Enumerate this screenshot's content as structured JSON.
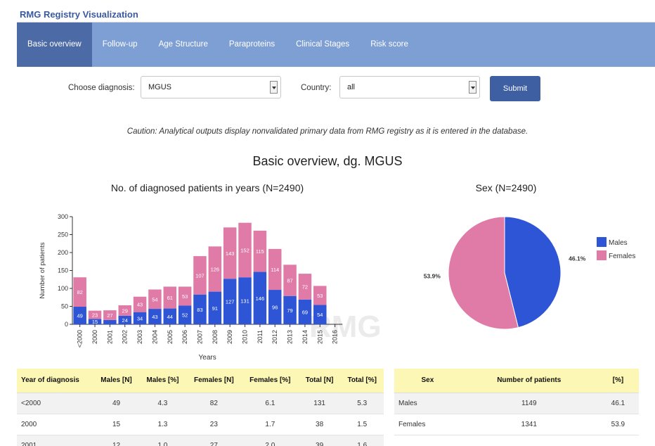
{
  "app": {
    "title": "RMG Registry Visualization"
  },
  "nav": [
    {
      "label": "Basic overview",
      "active": true
    },
    {
      "label": "Follow-up"
    },
    {
      "label": "Age Structure"
    },
    {
      "label": "Paraproteins"
    },
    {
      "label": "Clinical Stages"
    },
    {
      "label": "Risk score"
    }
  ],
  "filters": {
    "diagnosis_label": "Choose diagnosis:",
    "diagnosis_value": "MGUS",
    "country_label": "Country:",
    "country_value": "all",
    "submit_label": "Submit"
  },
  "caution": "Caution: Analytical outputs display nonvalidated primary data from RMG registry as it is entered in the database.",
  "main_title": "Basic overview, dg. MGUS",
  "colors": {
    "males": "#2e55d6",
    "females": "#e07ba8",
    "nav": "#7d9fd3",
    "nav_active": "#4b6aa6",
    "header_row": "#fdf7b5"
  },
  "chart_data": [
    {
      "type": "bar",
      "stacked": true,
      "title": "No. of diagnosed patients in years (N=2490)",
      "xlabel": "Years",
      "ylabel": "Number of patients",
      "ylim": [
        0,
        300
      ],
      "yticks": [
        0,
        50,
        100,
        150,
        200,
        250,
        300
      ],
      "categories": [
        "<2000",
        "2000",
        "2001",
        "2002",
        "2003",
        "2004",
        "2005",
        "2006",
        "2007",
        "2008",
        "2009",
        "2010",
        "2011",
        "2012",
        "2013",
        "2014",
        "2015",
        "2016"
      ],
      "series": [
        {
          "name": "Males",
          "values": [
            49,
            15,
            12,
            24,
            34,
            43,
            44,
            52,
            83,
            91,
            127,
            131,
            146,
            96,
            79,
            69,
            54,
            0
          ],
          "labels": [
            "49",
            "15",
            "",
            "24",
            "34",
            "43",
            "44",
            "52",
            "83",
            "91",
            "127",
            "131",
            "146",
            "96",
            "79",
            "69",
            "54",
            ""
          ]
        },
        {
          "name": "Females",
          "values": [
            82,
            23,
            27,
            29,
            43,
            54,
            61,
            53,
            107,
            126,
            143,
            152,
            115,
            114,
            87,
            72,
            53,
            0
          ],
          "labels": [
            "82",
            "23",
            "27",
            "29",
            "43",
            "54",
            "61",
            "53",
            "107",
            "126",
            "143",
            "152",
            "115",
            "114",
            "87",
            "72",
            "53",
            ""
          ]
        }
      ]
    },
    {
      "type": "pie",
      "title": "Sex (N=2490)",
      "legend": "right",
      "slices": [
        {
          "name": "Males",
          "value": 46.1,
          "label": "46.1%"
        },
        {
          "name": "Females",
          "value": 53.9,
          "label": "53.9%"
        }
      ]
    }
  ],
  "table_years": {
    "headers": [
      "Year of diagnosis",
      "Males [N]",
      "Males [%]",
      "Females [N]",
      "Females [%]",
      "Total [N]",
      "Total [%]"
    ],
    "rows": [
      [
        "<2000",
        "49",
        "4.3",
        "82",
        "6.1",
        "131",
        "5.3"
      ],
      [
        "2000",
        "15",
        "1.3",
        "23",
        "1.7",
        "38",
        "1.5"
      ],
      [
        "2001",
        "12",
        "1.0",
        "27",
        "2.0",
        "39",
        "1.6"
      ]
    ]
  },
  "table_sex": {
    "headers": [
      "Sex",
      "Number of patients",
      "[%]"
    ],
    "rows": [
      [
        "Males",
        "1149",
        "46.1"
      ],
      [
        "Females",
        "1341",
        "53.9"
      ]
    ]
  }
}
